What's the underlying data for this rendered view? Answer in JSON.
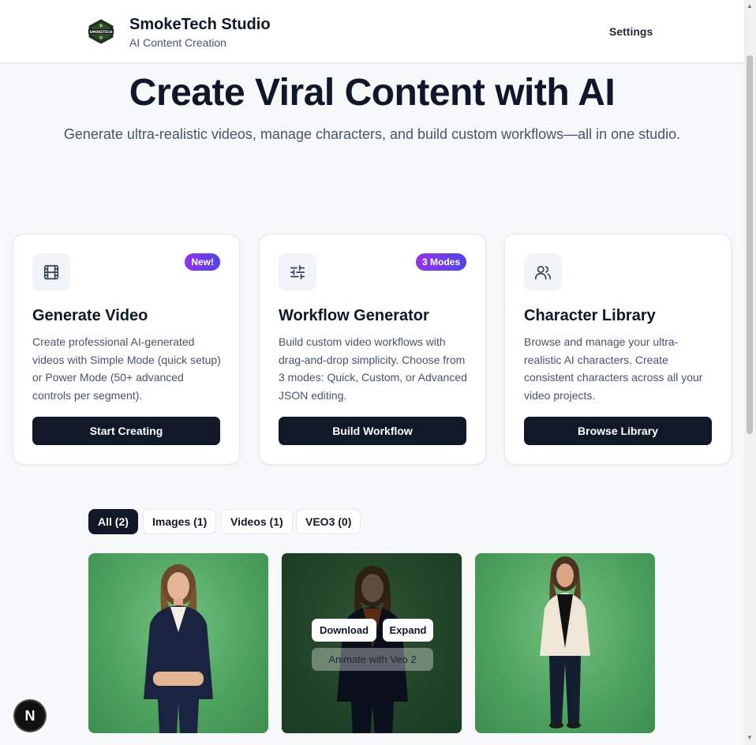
{
  "header": {
    "brand_title": "SmokeTech Studio",
    "brand_subtitle": "AI Content Creation",
    "logo_text": "SMOKETECH",
    "settings_label": "Settings"
  },
  "hero": {
    "title": "Create Viral Content with AI",
    "subtitle": "Generate ultra-realistic videos, manage characters, and build custom workflows—all in one studio."
  },
  "cards": [
    {
      "icon": "film-icon",
      "badge": "New!",
      "title": "Generate Video",
      "description": "Create professional AI-generated videos with Simple Mode (quick setup) or Power Mode (50+ advanced controls per segment).",
      "button": "Start Creating"
    },
    {
      "icon": "sliders-icon",
      "badge": "3 Modes",
      "title": "Workflow Generator",
      "description": "Build custom video workflows with drag-and-drop simplicity. Choose from 3 modes: Quick, Custom, or Advanced JSON editing.",
      "button": "Build Workflow"
    },
    {
      "icon": "users-icon",
      "badge": "",
      "title": "Character Library",
      "description": "Browse and manage your ultra-realistic AI characters. Create consistent characters across all your video projects.",
      "button": "Browse Library"
    }
  ],
  "filters": [
    {
      "label": "All (2)",
      "active": true
    },
    {
      "label": "Images (1)",
      "active": false
    },
    {
      "label": "Videos (1)",
      "active": false
    },
    {
      "label": "VEO3 (0)",
      "active": false
    }
  ],
  "gallery": {
    "overlay_buttons": {
      "download": "Download",
      "expand": "Expand",
      "animate": "Animate with Veo 2"
    }
  },
  "dev_badge": "N",
  "colors": {
    "primary_button": "#111827",
    "badge_gradient_start": "#9333ea",
    "badge_gradient_end": "#4f46e5",
    "gallery_green": "#5aaa6a"
  }
}
